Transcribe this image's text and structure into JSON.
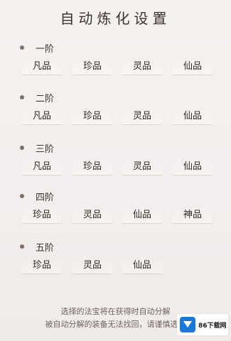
{
  "title": "自动炼化设置",
  "tiers": [
    {
      "label": "一阶",
      "grades": [
        "凡品",
        "珍品",
        "灵品",
        "仙品"
      ]
    },
    {
      "label": "二阶",
      "grades": [
        "凡品",
        "珍品",
        "灵品",
        "仙品"
      ]
    },
    {
      "label": "三阶",
      "grades": [
        "凡品",
        "珍品",
        "灵品",
        "仙品"
      ]
    },
    {
      "label": "四阶",
      "grades": [
        "珍品",
        "灵品",
        "仙品",
        "神品"
      ]
    },
    {
      "label": "五阶",
      "grades": [
        "珍品",
        "灵品",
        "仙品"
      ]
    }
  ],
  "footer": {
    "line1": "选择的法宝将在获得时自动分解",
    "line2": "被自动分解的装备无法找回，请谨慎选择"
  },
  "watermark": {
    "text": "86下载网"
  }
}
